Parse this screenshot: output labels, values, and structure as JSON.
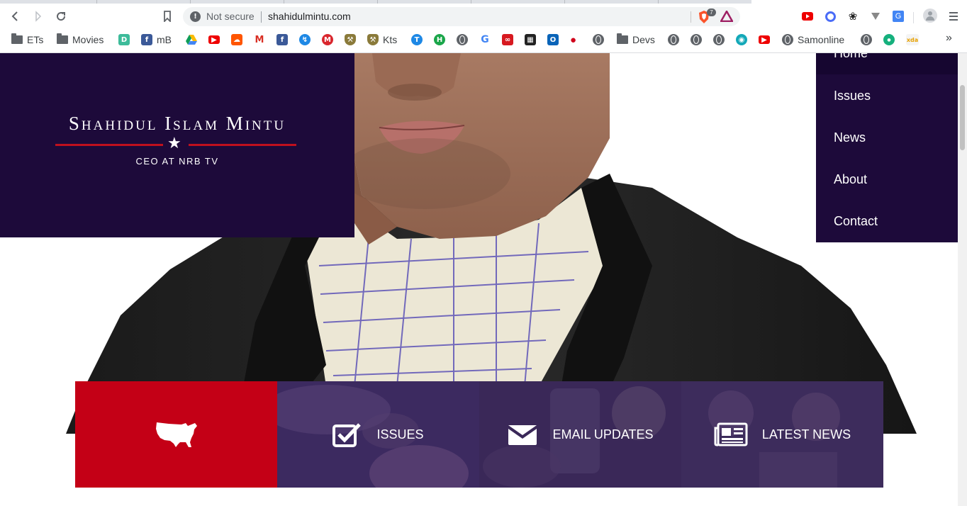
{
  "browser": {
    "security_status": "Not secure",
    "url": "shahidulmintu.com",
    "brave_badge_count": "7",
    "bookmarks": [
      {
        "label": "ETs",
        "icon": "folder-icon"
      },
      {
        "label": "Movies",
        "icon": "folder-icon"
      },
      {
        "label": "mB",
        "icon": "facebook-icon"
      },
      {
        "label": "Kts",
        "icon": "shield-icon"
      },
      {
        "label": "Devs",
        "icon": "folder-icon"
      },
      {
        "label": "Samonline",
        "icon": "globe-icon"
      }
    ]
  },
  "site": {
    "name": "Shahidul Islam Mintu",
    "tagline": "CEO AT NRB TV",
    "nav": [
      "Home",
      "Issues",
      "News",
      "About",
      "Contact"
    ],
    "features": [
      {
        "label": "",
        "icon": "usa-map-icon",
        "color": "#c40016"
      },
      {
        "label": "ISSUES",
        "icon": "checkbox-icon",
        "color": "#3c2a60"
      },
      {
        "label": "EMAIL UPDATES",
        "icon": "envelope-icon",
        "color": "#3a2858"
      },
      {
        "label": "LATEST NEWS",
        "icon": "newspaper-icon",
        "color": "#3d2c5c"
      }
    ]
  },
  "colors": {
    "brand_navy": "#1d0a3a",
    "accent_red": "#c0101e",
    "feature_red": "#c40016"
  }
}
